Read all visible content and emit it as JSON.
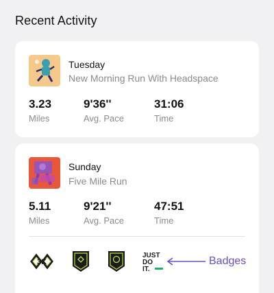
{
  "section": {
    "title": "Recent Activity"
  },
  "activities": [
    {
      "day": "Tuesday",
      "name": "New Morning Run With Headspace",
      "thumb_bg": "#f4c98a",
      "stats": [
        {
          "value": "3.23",
          "label": "Miles"
        },
        {
          "value": "9'36''",
          "label": "Avg. Pace"
        },
        {
          "value": "31:06",
          "label": "Time"
        }
      ]
    },
    {
      "day": "Sunday",
      "name": "Five Mile Run",
      "thumb_bg": "#e9573a",
      "stats": [
        {
          "value": "5.11",
          "label": "Miles"
        },
        {
          "value": "9'21''",
          "label": "Avg. Pace"
        },
        {
          "value": "47:51",
          "label": "Time"
        }
      ],
      "badges": [
        {
          "icon": "distance-badge-icon"
        },
        {
          "icon": "shield-badge-icon"
        },
        {
          "icon": "shield-badge-icon"
        },
        {
          "icon": "just-do-it-badge-icon",
          "text": [
            "JUST",
            "DO",
            "IT."
          ]
        }
      ]
    }
  ],
  "annotation": {
    "label": "Badges",
    "color": "#6b4fc8"
  }
}
